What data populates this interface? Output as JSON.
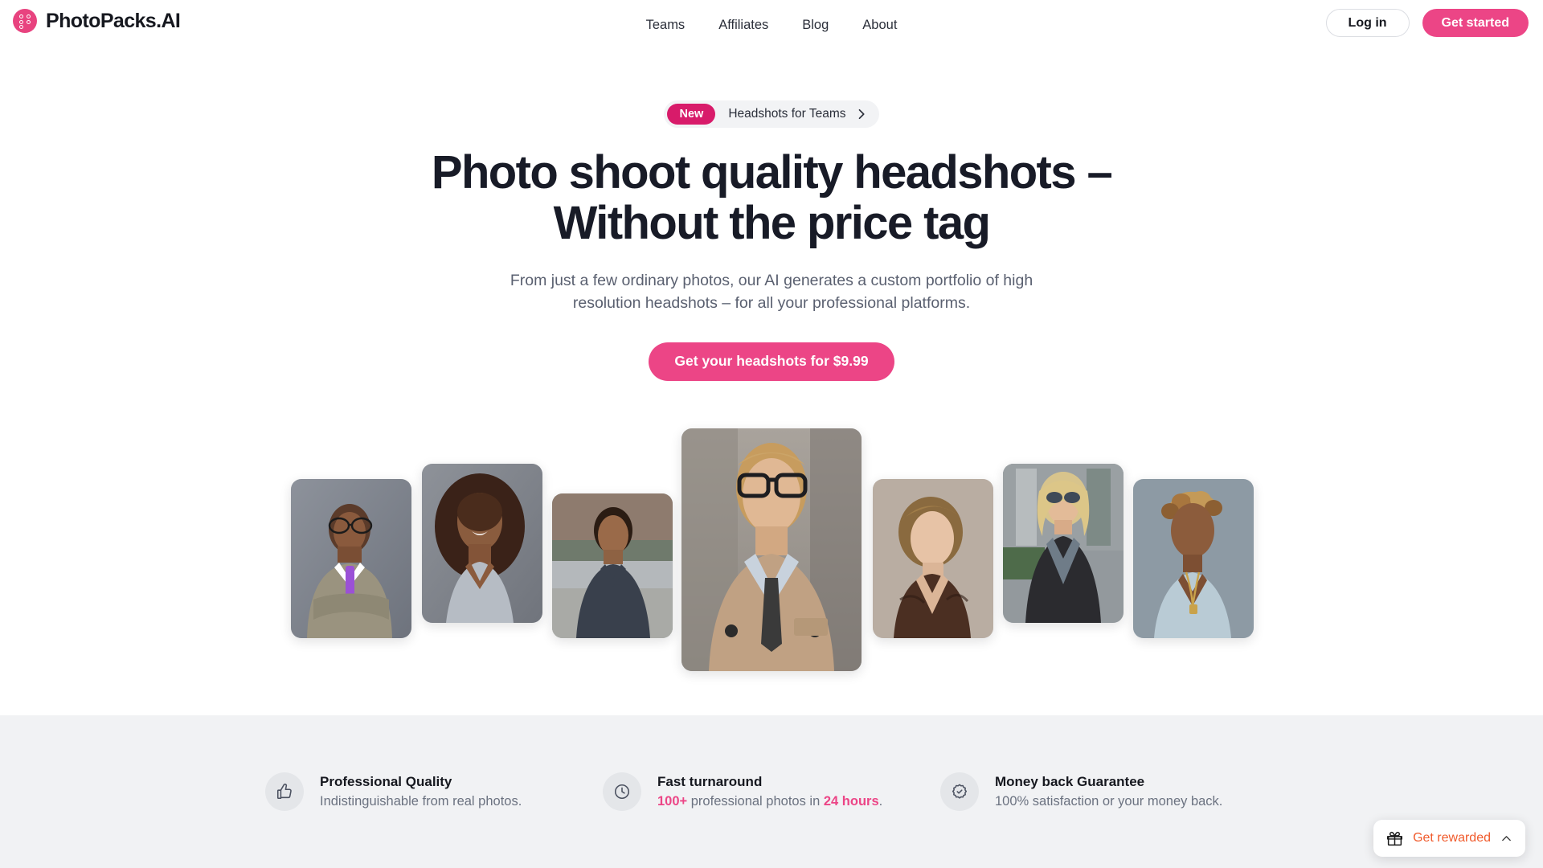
{
  "header": {
    "brand_name": "PhotoPacks.AI",
    "logo_icon": "dots-circle-logo-icon",
    "nav": [
      {
        "label": "Teams"
      },
      {
        "label": "Affiliates"
      },
      {
        "label": "Blog"
      },
      {
        "label": "About"
      }
    ],
    "login_label": "Log in",
    "get_started_label": "Get started"
  },
  "hero": {
    "badge": {
      "tag": "New",
      "text": "Headshots for Teams",
      "chevron_icon": "chevron-right-icon"
    },
    "headline_line1": "Photo shoot quality headshots –",
    "headline_line2": "Without the price tag",
    "subhead_line1": "From just a few ordinary photos, our AI generates a custom portfolio of high",
    "subhead_line2": "resolution headshots – for all your professional platforms.",
    "cta_label": "Get your headshots for $9.99"
  },
  "gallery": {
    "photos": [
      {
        "alt": "headshot-man-grey-suit-purple-tie"
      },
      {
        "alt": "headshot-woman-curly-hair-grey-top"
      },
      {
        "alt": "headshot-man-navy-polo-street"
      },
      {
        "alt": "headshot-man-tan-trench-coat-glasses"
      },
      {
        "alt": "headshot-woman-short-blonde-hair-brown-blouse"
      },
      {
        "alt": "headshot-man-leather-jacket-sunglasses"
      },
      {
        "alt": "headshot-woman-updo-light-blue-top"
      }
    ]
  },
  "features": [
    {
      "icon": "thumbs-up-icon",
      "title": "Professional Quality",
      "desc_pre": "Indistinguishable from real photos.",
      "desc_hl1": "",
      "desc_mid": "",
      "desc_hl2": "",
      "desc_post": ""
    },
    {
      "icon": "clock-icon",
      "title": "Fast turnaround",
      "desc_pre": "",
      "desc_hl1": "100+",
      "desc_mid": " professional photos in ",
      "desc_hl2": "24 hours",
      "desc_post": "."
    },
    {
      "icon": "badge-check-icon",
      "title": "Money back Guarantee",
      "desc_pre": "100% satisfaction or your money back.",
      "desc_hl1": "",
      "desc_mid": "",
      "desc_hl2": "",
      "desc_post": ""
    }
  ],
  "reward_widget": {
    "label": "Get rewarded",
    "gift_icon": "gift-icon",
    "chevron_icon": "chevron-up-icon"
  },
  "colors": {
    "brand_pink": "#EC4586",
    "badge_pink": "#D81B6A",
    "text_dark": "#16181F",
    "text_muted": "#6B7280",
    "feature_bg": "#F1F2F4",
    "reward_orange": "#F05A2B"
  }
}
